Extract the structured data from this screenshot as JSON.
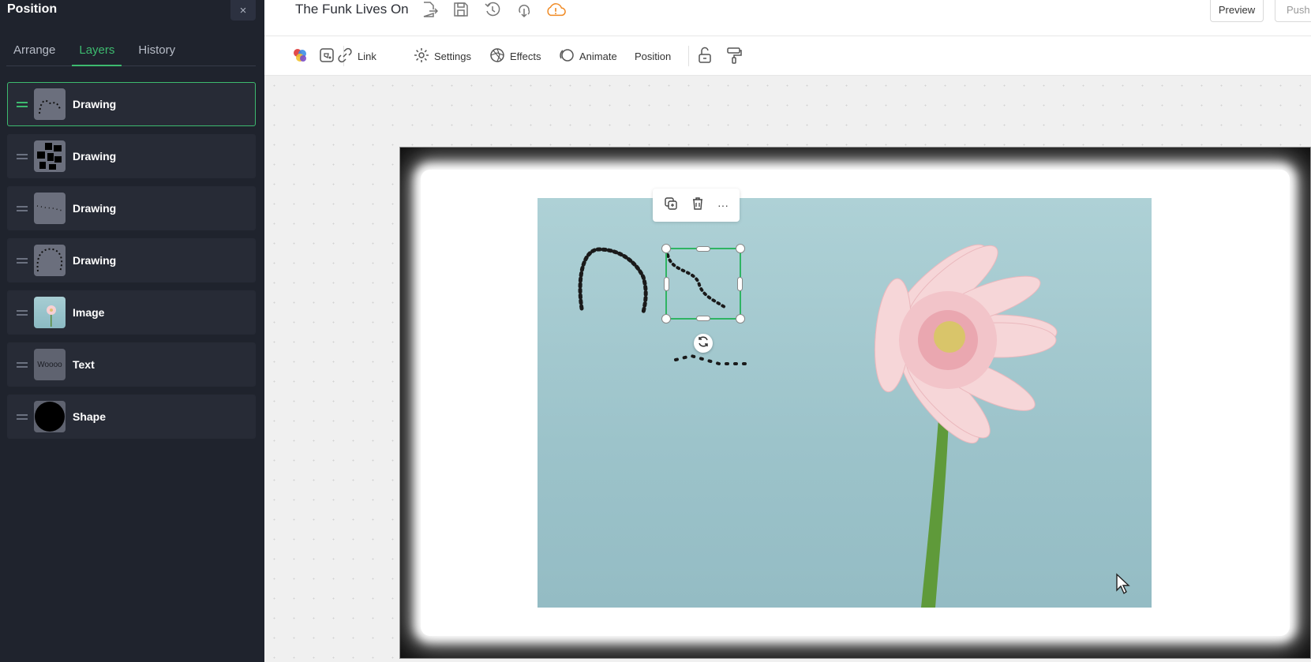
{
  "panel": {
    "title": "Position",
    "close_label": "×",
    "tabs": [
      {
        "label": "Arrange",
        "active": false
      },
      {
        "label": "Layers",
        "active": true
      },
      {
        "label": "History",
        "active": false
      }
    ],
    "layers": [
      {
        "label": "Drawing",
        "thumb": "drawing-loops",
        "selected": true
      },
      {
        "label": "Drawing",
        "thumb": "drawing-blocks",
        "selected": false
      },
      {
        "label": "Drawing",
        "thumb": "drawing-dots",
        "selected": false
      },
      {
        "label": "Drawing",
        "thumb": "drawing-arc",
        "selected": false
      },
      {
        "label": "Image",
        "thumb": "flower-image",
        "selected": false
      },
      {
        "label": "Text",
        "thumb_text": "Woooo",
        "selected": false
      },
      {
        "label": "Shape",
        "thumb": "black-circle",
        "selected": false
      }
    ],
    "collapse_icon": "chevron-left-icon"
  },
  "topbar": {
    "title": "The Funk Lives On",
    "icons": [
      "export-icon",
      "save-icon",
      "history-icon",
      "download-icon",
      "cloud-warning-icon"
    ],
    "preview_label": "Preview",
    "push_label": "Push t"
  },
  "toolbar": {
    "link_label": "Link",
    "settings_label": "Settings",
    "effects_label": "Effects",
    "animate_label": "Animate",
    "position_label": "Position",
    "icons": [
      "color-palette-icon",
      "fill-icon",
      "link-icon",
      "gear-icon",
      "effects-icon",
      "animate-icon",
      "unlock-icon",
      "paint-roller-icon"
    ]
  },
  "selection": {
    "actions": [
      "duplicate-icon",
      "trash-icon",
      "more-icon"
    ],
    "more_label": "···"
  },
  "colors": {
    "panel_bg": "#1f232d",
    "accent": "#3dba6f",
    "warning": "#f08a24"
  }
}
